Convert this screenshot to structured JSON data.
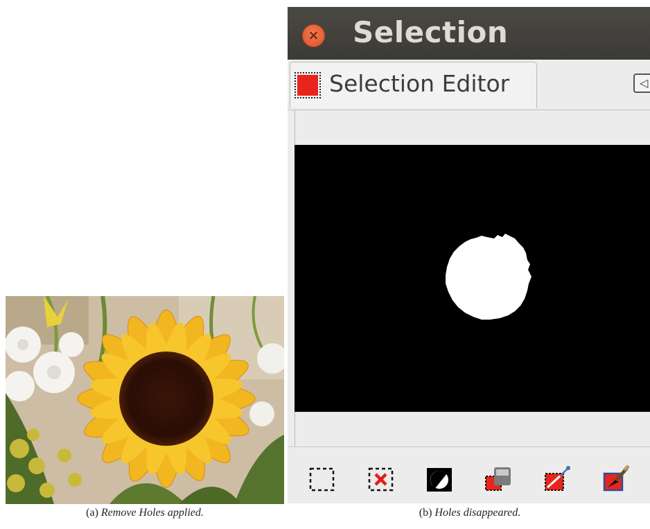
{
  "window": {
    "title": "Selection"
  },
  "tab": {
    "label": "Selection Editor",
    "icon": "selection-editor-icon"
  },
  "toolbar": {
    "buttons": [
      {
        "icon": "select-all-icon"
      },
      {
        "icon": "select-none-icon"
      },
      {
        "icon": "invert-selection-icon"
      },
      {
        "icon": "save-to-channel-icon"
      },
      {
        "icon": "selection-to-path-icon"
      },
      {
        "icon": "stroke-selection-icon"
      }
    ]
  },
  "captions": {
    "a": {
      "label": "(a)",
      "text": "Remove Holes applied."
    },
    "b": {
      "label": "(b)",
      "text": "Holes disappeared."
    }
  },
  "colors": {
    "accent": "#e8251c",
    "titlebar": "#3f3e3a",
    "close": "#e2592f"
  }
}
